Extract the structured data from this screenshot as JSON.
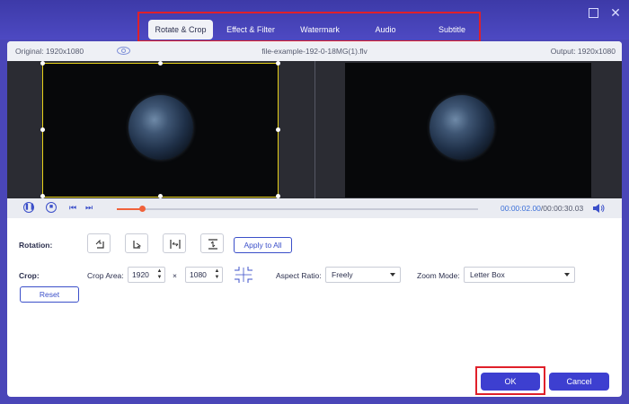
{
  "window": {
    "maximize_icon": "maximize-icon",
    "close_icon": "close-icon",
    "close_glyph": "✕"
  },
  "tabs": [
    {
      "label": "Rotate & Crop",
      "active": true
    },
    {
      "label": "Effect & Filter",
      "active": false
    },
    {
      "label": "Watermark",
      "active": false
    },
    {
      "label": "Audio",
      "active": false
    },
    {
      "label": "Subtitle",
      "active": false
    }
  ],
  "info": {
    "original": "Original: 1920x1080",
    "filename": "file-example-192-0-18MG(1).flv",
    "output": "Output: 1920x1080",
    "eye_icon": "eye-icon"
  },
  "player": {
    "current_time": "00:00:02.00",
    "separator": "/",
    "total_time": "00:00:30.03",
    "progress": 0.07,
    "pause_glyph": "❚❚",
    "stop_glyph": "■",
    "prev_glyph": "⏮",
    "next_glyph": "⏭"
  },
  "rotation": {
    "label": "Rotation:",
    "buttons": [
      "rotate-left-icon",
      "rotate-right-icon",
      "flip-horizontal-icon",
      "flip-vertical-icon"
    ],
    "apply_label": "Apply to All"
  },
  "crop": {
    "label": "Crop:",
    "area_label": "Crop Area:",
    "width": "1920",
    "times": "×",
    "height": "1080",
    "center_icon": "crop-center-icon",
    "aspect_label": "Aspect Ratio:",
    "aspect_value": "Freely",
    "zoom_label": "Zoom Mode:",
    "zoom_value": "Letter Box",
    "reset_label": "Reset"
  },
  "footer": {
    "ok_label": "OK",
    "cancel_label": "Cancel"
  },
  "colors": {
    "accent": "#3d3fd0",
    "frame": "#4a46b8",
    "progress": "#f0623b",
    "crop_frame": "#e8d21a",
    "highlight": "#e0202a"
  }
}
